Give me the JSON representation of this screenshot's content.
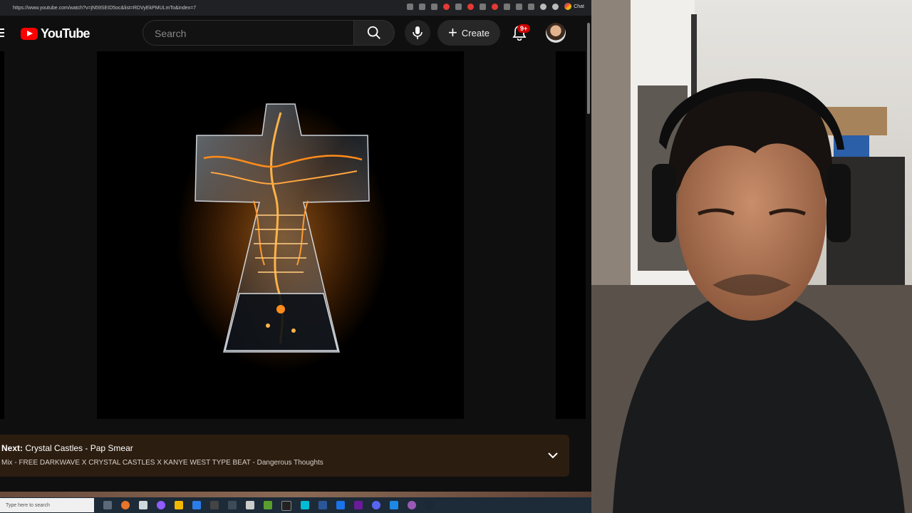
{
  "browser": {
    "url": "https://www.youtube.com/watch?v=jN59SEID5oc&list=RDVyEkPMULmTo&index=7",
    "chat_extension_label": "Chat"
  },
  "header": {
    "logo_text": "YouTube",
    "search_placeholder": "Search",
    "create_label": "Create",
    "notification_count": "9+"
  },
  "up_next": {
    "prefix": "Next:",
    "title": "Crystal Castles - Pap Smear",
    "mix_title": "Mix - FREE DARKWAVE X CRYSTAL CASTLES X KANYE WEST TYPE BEAT - Dangerous Thoughts"
  },
  "taskbar": {
    "search_placeholder": "Type here to search"
  },
  "colors": {
    "brand_red": "#ff0000",
    "badge_red": "#cc0000",
    "next_card_bg": "#2b1d10",
    "page_bg": "#0f0f0f"
  }
}
